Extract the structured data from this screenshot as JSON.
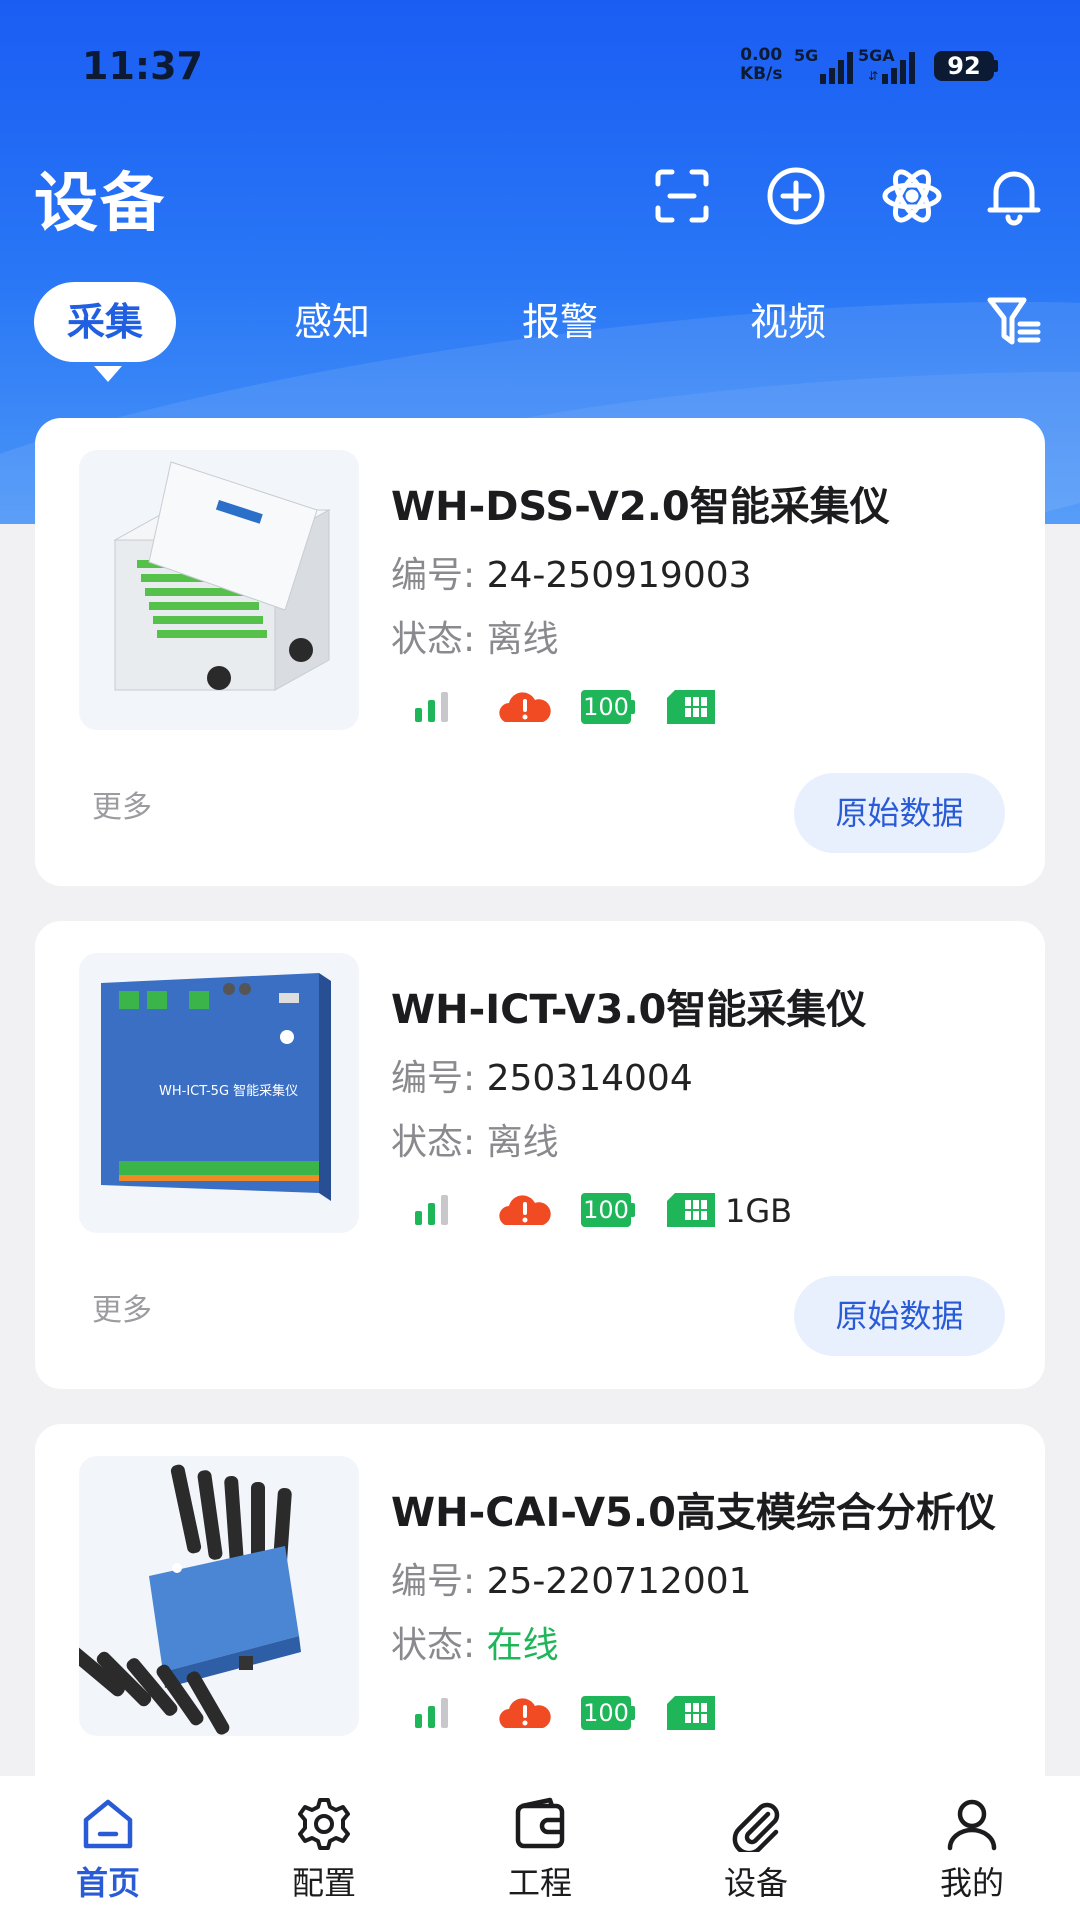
{
  "status_bar": {
    "time": "11:37",
    "net_speed_value": "0.00",
    "net_speed_unit": "KB/s",
    "sim1_label": "5G",
    "sim2_label": "5GA",
    "battery": "92"
  },
  "header": {
    "title": "设备",
    "icons": [
      "scan-icon",
      "add-circle-icon",
      "atom-icon",
      "bell-icon"
    ]
  },
  "tabs": [
    {
      "label": "采集",
      "active": true
    },
    {
      "label": "感知",
      "active": false
    },
    {
      "label": "报警",
      "active": false
    },
    {
      "label": "视频",
      "active": false
    }
  ],
  "colors": {
    "brand_blue": "#1a5df3",
    "online_green": "#20b559",
    "alarm_red": "#f04b23",
    "indicator_green": "#1fb65a"
  },
  "devices": [
    {
      "name": "WH-DSS-V2.0智能采集仪",
      "id_label": "编号:",
      "id_value": "24-250919003",
      "status_label": "状态:",
      "status_value": "离线",
      "battery": "100",
      "storage": "",
      "more": "更多",
      "raw_data": "原始数据"
    },
    {
      "name": "WH-ICT-V3.0智能采集仪",
      "id_label": "编号:",
      "id_value": "250314004",
      "status_label": "状态:",
      "status_value": "离线",
      "battery": "100",
      "storage": "1GB",
      "more": "更多",
      "raw_data": "原始数据"
    },
    {
      "name": "WH-CAI-V5.0高支模综合分析仪",
      "id_label": "编号:",
      "id_value": "25-220712001",
      "status_label": "状态:",
      "status_value": "在线",
      "battery": "100",
      "storage": ""
    }
  ],
  "device_images": {
    "ict_label": "WH-ICT-5G 智能采集仪"
  },
  "bottom_nav": [
    {
      "label": "首页",
      "icon": "home-icon",
      "active": true
    },
    {
      "label": "配置",
      "icon": "gear-icon",
      "active": false
    },
    {
      "label": "工程",
      "icon": "wallet-icon",
      "active": false
    },
    {
      "label": "设备",
      "icon": "paperclip-icon",
      "active": false
    },
    {
      "label": "我的",
      "icon": "user-icon",
      "active": false
    }
  ]
}
